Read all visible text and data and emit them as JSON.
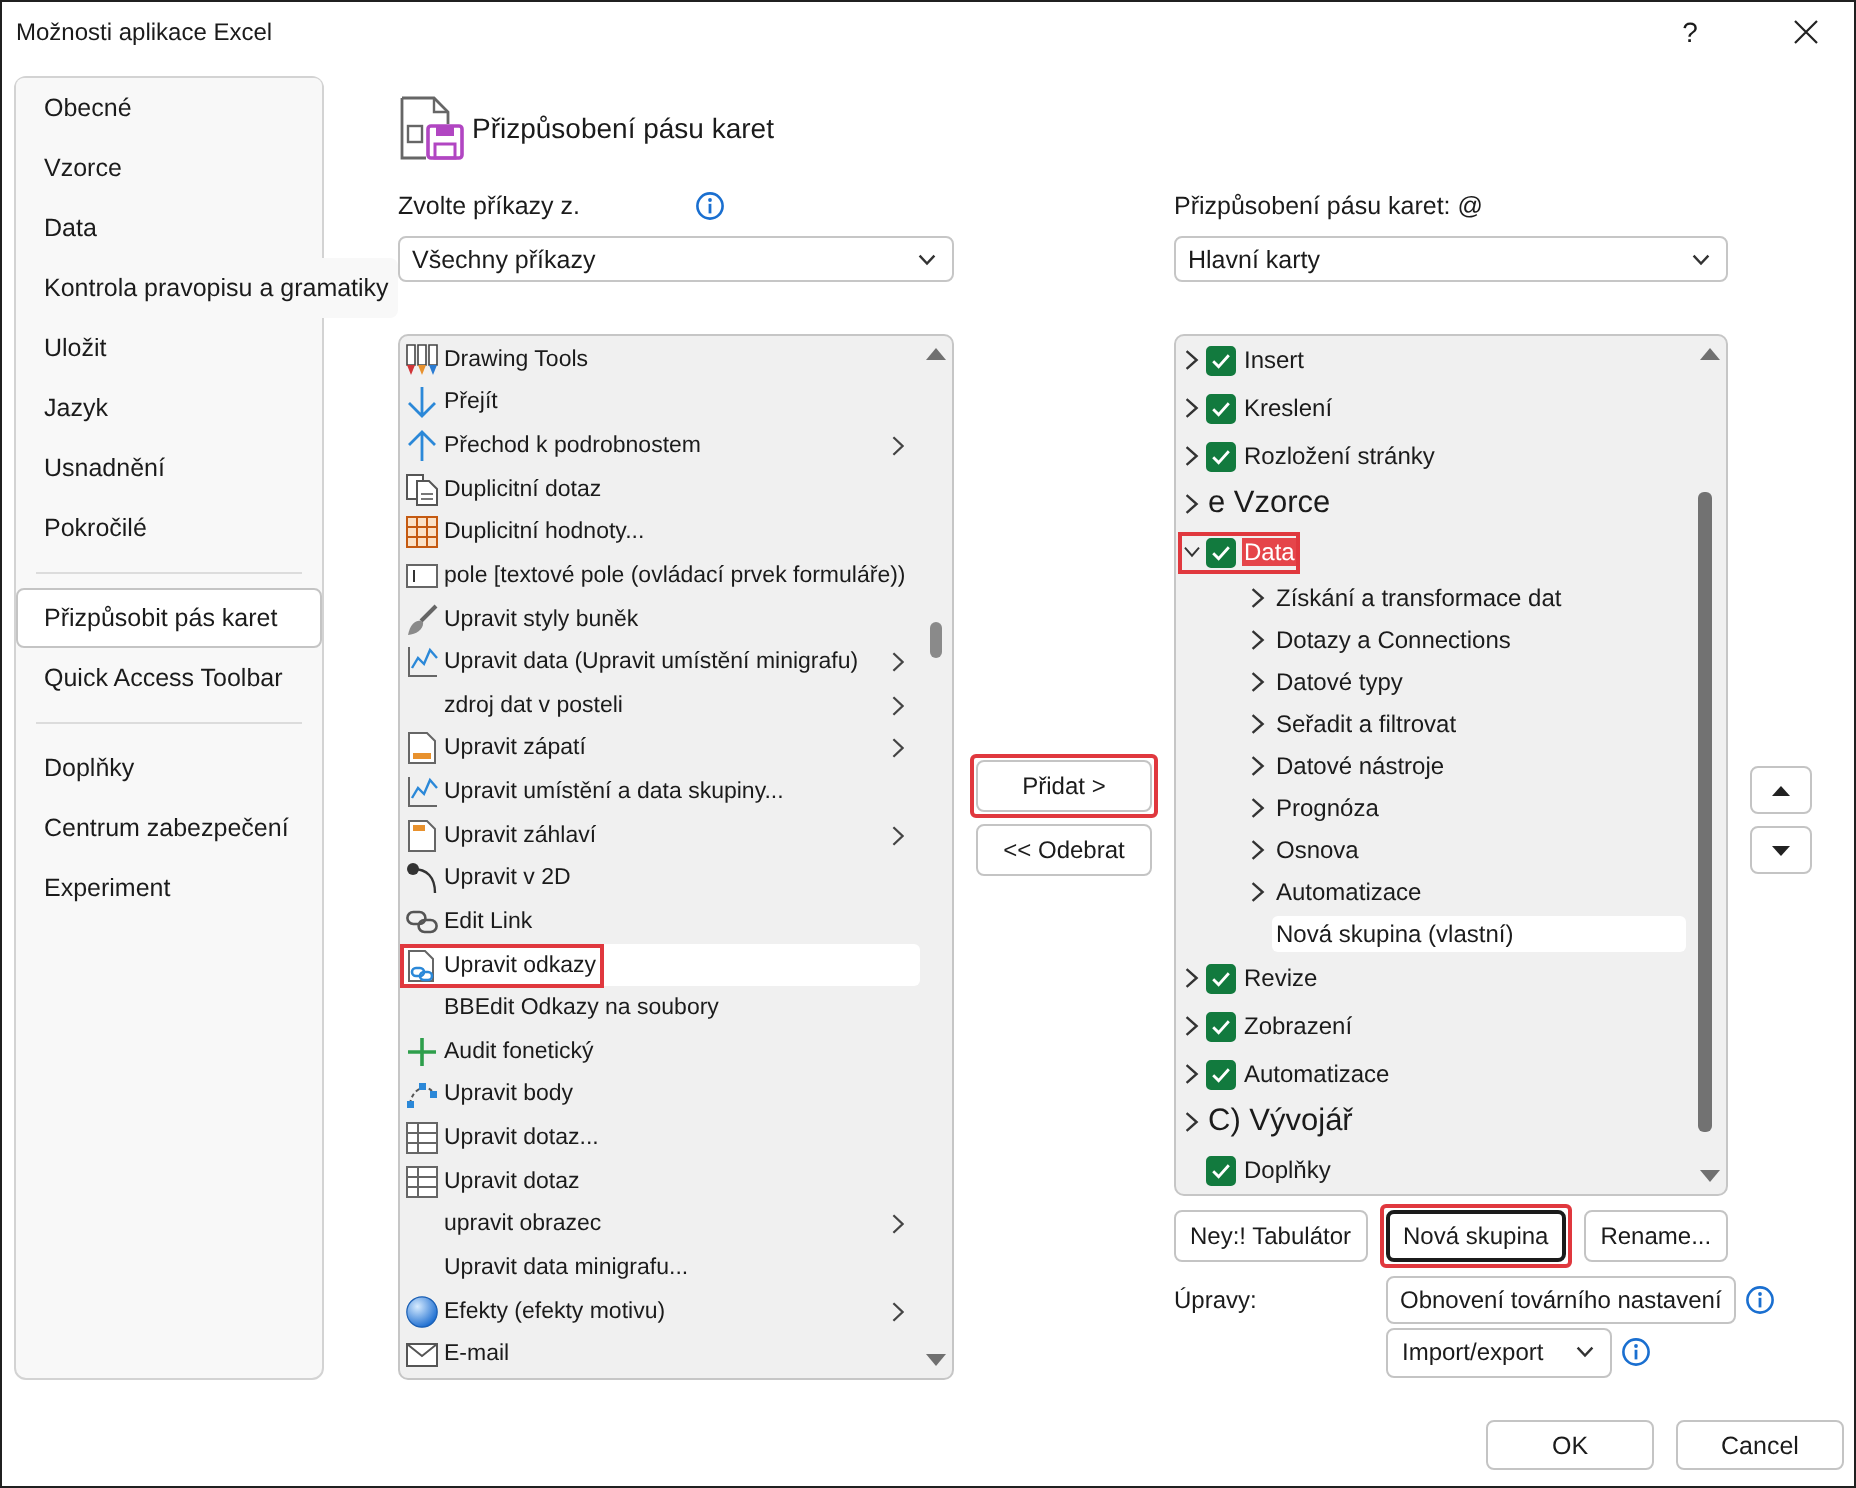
{
  "window": {
    "title": "Možnosti aplikace Excel",
    "help": "?"
  },
  "sidebar": {
    "groups": [
      {
        "items": [
          {
            "label": "Obecné",
            "selected": false
          },
          {
            "label": "Vzorce",
            "selected": false
          },
          {
            "label": "Data",
            "selected": false
          },
          {
            "label": "Kontrola pravopisu a gramatiky",
            "selected": false
          },
          {
            "label": "Uložit",
            "selected": false
          },
          {
            "label": "Jazyk",
            "selected": false
          },
          {
            "label": "Usnadnění",
            "selected": false
          },
          {
            "label": "Pokročilé",
            "selected": false
          }
        ]
      },
      {
        "items": [
          {
            "label": "Přizpůsobit pás karet",
            "selected": true
          },
          {
            "label": "Quick Access Toolbar",
            "selected": false
          }
        ]
      },
      {
        "items": [
          {
            "label": "Doplňky",
            "selected": false
          },
          {
            "label": "Centrum zabezpečení",
            "selected": false
          },
          {
            "label": "Experiment",
            "selected": false
          }
        ]
      }
    ]
  },
  "heading": "Přizpůsobení pásu karet",
  "commands": {
    "label": "Zvolte příkazy z.",
    "dropdown": "Všechny příkazy",
    "items": [
      {
        "label": "Drawing Tools",
        "submenu": false,
        "selected": false,
        "callout": false
      },
      {
        "label": "Přejít",
        "submenu": false,
        "selected": false,
        "callout": false
      },
      {
        "label": "Přechod k podrobnostem",
        "submenu": true,
        "selected": false,
        "callout": false
      },
      {
        "label": "Duplicitní dotaz",
        "submenu": false,
        "selected": false,
        "callout": false
      },
      {
        "label": "Duplicitní hodnoty...",
        "submenu": false,
        "selected": false,
        "callout": false
      },
      {
        "label": "pole [textové pole (ovládací prvek formuláře))",
        "submenu": false,
        "selected": false,
        "callout": false
      },
      {
        "label": "Upravit styly buněk",
        "submenu": false,
        "selected": false,
        "callout": false
      },
      {
        "label": "Upravit data (Upravit umístění minigrafu)",
        "submenu": true,
        "selected": false,
        "callout": false
      },
      {
        "label": "zdroj dat v posteli",
        "submenu": true,
        "selected": false,
        "callout": false
      },
      {
        "label": "Upravit zápatí",
        "submenu": true,
        "selected": false,
        "callout": false
      },
      {
        "label": "Upravit umístění a data skupiny...",
        "submenu": false,
        "selected": false,
        "callout": false
      },
      {
        "label": "Upravit záhlaví",
        "submenu": true,
        "selected": false,
        "callout": false
      },
      {
        "label": "Upravit v 2D",
        "submenu": false,
        "selected": false,
        "callout": false
      },
      {
        "label": "Edit Link",
        "submenu": false,
        "selected": false,
        "callout": false
      },
      {
        "label": "Upravit odkazy",
        "submenu": false,
        "selected": true,
        "callout": true
      },
      {
        "label": "BBEdit Odkazy na soubory",
        "submenu": false,
        "selected": false,
        "callout": false
      },
      {
        "label": "Audit fonetický",
        "submenu": false,
        "selected": false,
        "callout": false
      },
      {
        "label": "Upravit body",
        "submenu": false,
        "selected": false,
        "callout": false
      },
      {
        "label": "Upravit dotaz...",
        "submenu": false,
        "selected": false,
        "callout": false
      },
      {
        "label": "Upravit dotaz",
        "submenu": false,
        "selected": false,
        "callout": false
      },
      {
        "label": "upravit obrazec",
        "submenu": true,
        "selected": false,
        "callout": false
      },
      {
        "label": "Upravit data minigrafu...",
        "submenu": false,
        "selected": false,
        "callout": false
      },
      {
        "label": "Efekty (efekty motivu)",
        "submenu": true,
        "selected": false,
        "callout": false
      },
      {
        "label": "E-mail",
        "submenu": false,
        "selected": false,
        "callout": false
      }
    ]
  },
  "transfer_buttons": [
    {
      "label": "Přidat >",
      "callout": true
    },
    {
      "label": "<< Odebrat",
      "callout": false
    }
  ],
  "ribbon": {
    "label": "Přizpůsobení pásu karet: @",
    "dropdown": "Hlavní karty",
    "tabs": [
      {
        "kind": "tab",
        "label": "Insert",
        "checked": true,
        "expandable": true,
        "expanded": false,
        "selected": false,
        "callout": false
      },
      {
        "kind": "tab",
        "label": "Kreslení",
        "checked": true,
        "expandable": true,
        "expanded": false,
        "selected": false,
        "callout": false
      },
      {
        "kind": "tab",
        "label": "Rozložení stránky",
        "checked": true,
        "expandable": true,
        "expanded": false,
        "selected": false,
        "callout": false
      },
      {
        "kind": "label",
        "label": "e Vzorce",
        "expandable": true,
        "expanded": false,
        "selected": false,
        "callout": false
      },
      {
        "kind": "tab",
        "label": "Data",
        "checked": true,
        "expandable": true,
        "expanded": true,
        "selected": false,
        "callout": true,
        "children": [
          {
            "label": "Získání a transformace dat",
            "expandable": true,
            "expanded": false,
            "selected": false
          },
          {
            "label": "Dotazy a Connections",
            "expandable": true,
            "expanded": false,
            "selected": false
          },
          {
            "label": "Datové typy",
            "expandable": true,
            "expanded": false,
            "selected": false
          },
          {
            "label": "Seřadit a filtrovat",
            "expandable": true,
            "expanded": false,
            "selected": false
          },
          {
            "label": "Datové nástroje",
            "expandable": true,
            "expanded": false,
            "selected": false
          },
          {
            "label": "Prognóza",
            "expandable": true,
            "expanded": false,
            "selected": false
          },
          {
            "label": "Osnova",
            "expandable": true,
            "expanded": false,
            "selected": false
          },
          {
            "label": "Automatizace",
            "expandable": true,
            "expanded": false,
            "selected": false
          },
          {
            "label": "Nová skupina (vlastní)",
            "expandable": false,
            "selected": true
          }
        ]
      },
      {
        "kind": "tab",
        "label": "Revize",
        "checked": true,
        "expandable": true,
        "expanded": false,
        "selected": false,
        "callout": false
      },
      {
        "kind": "tab",
        "label": "Zobrazení",
        "checked": true,
        "expandable": true,
        "expanded": false,
        "selected": false,
        "callout": false
      },
      {
        "kind": "tab",
        "label": "Automatizace",
        "checked": true,
        "expandable": true,
        "expanded": false,
        "selected": false,
        "callout": false
      },
      {
        "kind": "label",
        "label": "C) Vývojář",
        "expandable": true,
        "expanded": false,
        "selected": false,
        "callout": false
      },
      {
        "kind": "tab",
        "label": "Doplňky",
        "checked": true,
        "expandable": false,
        "selected": false,
        "callout": false
      }
    ],
    "buttons": [
      {
        "label": "Ney:! Tabulátor",
        "focused": false,
        "callout": false
      },
      {
        "label": "Nová skupina",
        "focused": true,
        "callout": true
      },
      {
        "label": "Rename...",
        "focused": false,
        "callout": false
      }
    ]
  },
  "customizations": {
    "label": "Úpravy:",
    "reset": "Obnovení továrního nastavení",
    "import_export": "Import/export"
  },
  "dialog_buttons": [
    "OK",
    "Cancel"
  ]
}
